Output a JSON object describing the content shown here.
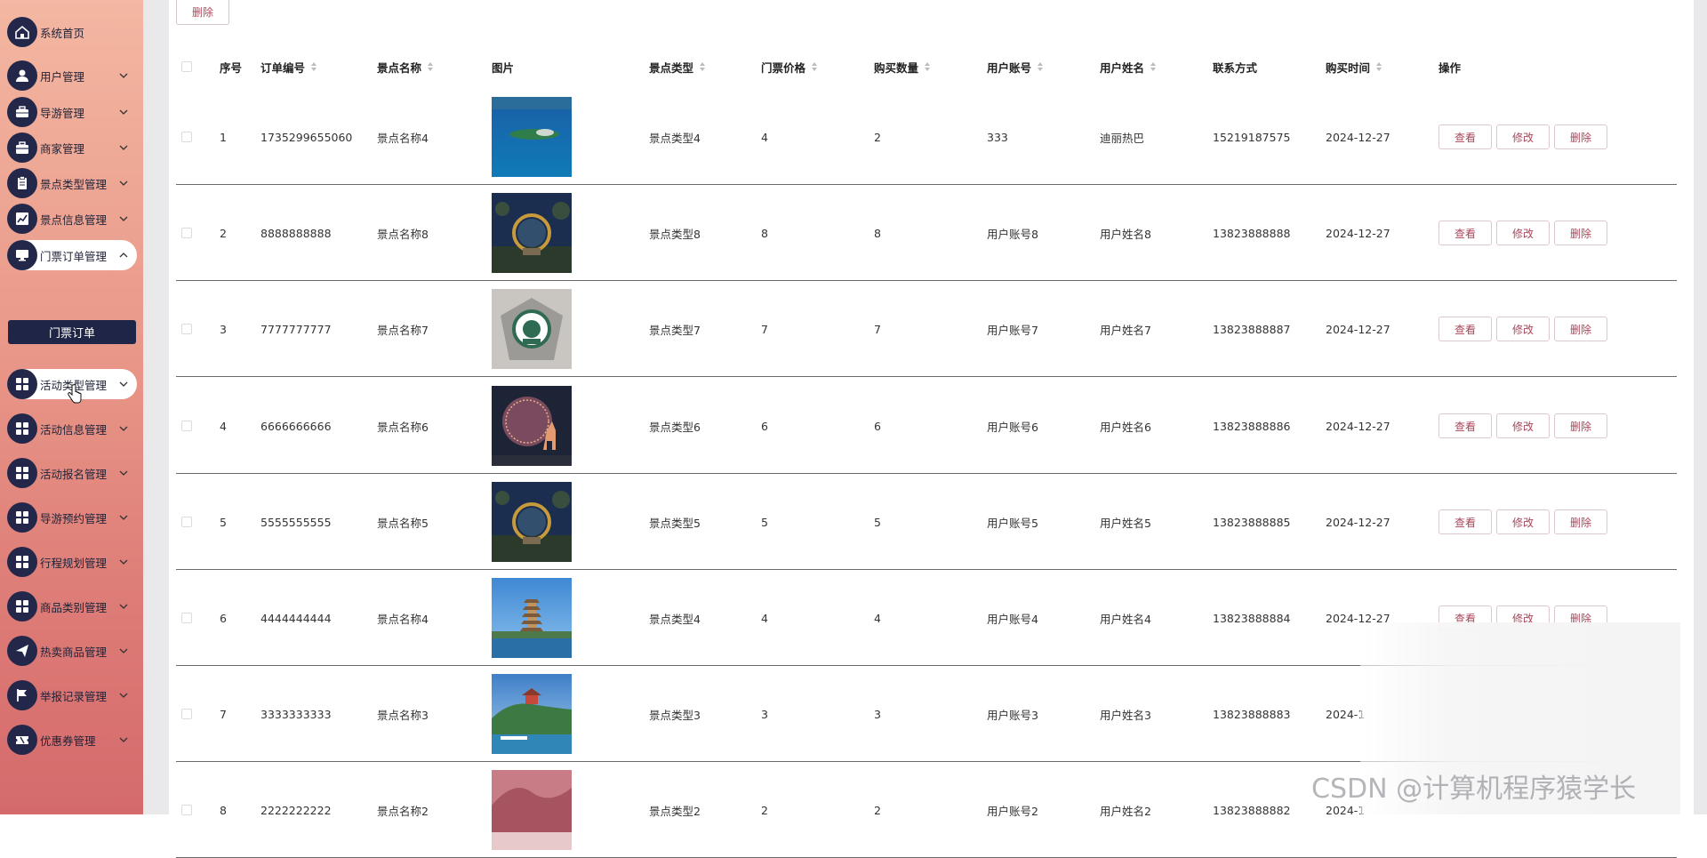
{
  "sidebar": {
    "items": [
      {
        "label": "系统首页",
        "icon": "home-icon",
        "caret": ""
      },
      {
        "label": "用户管理",
        "icon": "user-icon",
        "caret": "down"
      },
      {
        "label": "导游管理",
        "icon": "guide-icon",
        "caret": "down"
      },
      {
        "label": "商家管理",
        "icon": "briefcase-icon",
        "caret": "down"
      },
      {
        "label": "景点类型管理",
        "icon": "clipboard-icon",
        "caret": "down"
      },
      {
        "label": "景点信息管理",
        "icon": "chart-icon",
        "caret": "down"
      },
      {
        "label": "门票订单管理",
        "icon": "monitor-icon",
        "caret": "up"
      },
      {
        "label": "活动类型管理",
        "icon": "grid-icon",
        "caret": "down"
      },
      {
        "label": "活动信息管理",
        "icon": "grid-icon",
        "caret": "down"
      },
      {
        "label": "活动报名管理",
        "icon": "grid-icon",
        "caret": "down"
      },
      {
        "label": "导游预约管理",
        "icon": "grid-icon",
        "caret": "down"
      },
      {
        "label": "行程规划管理",
        "icon": "grid-icon",
        "caret": "down"
      },
      {
        "label": "商品类别管理",
        "icon": "grid-icon",
        "caret": "down"
      },
      {
        "label": "热卖商品管理",
        "icon": "send-icon",
        "caret": "down"
      },
      {
        "label": "举报记录管理",
        "icon": "flag-icon",
        "caret": "down"
      },
      {
        "label": "优惠券管理",
        "icon": "ticket-icon",
        "caret": "down"
      }
    ],
    "submenu": {
      "label": "门票订单"
    }
  },
  "toolbar": {
    "delete_label": "删除"
  },
  "table": {
    "columns": [
      "序号",
      "订单编号",
      "景点名称",
      "图片",
      "景点类型",
      "门票价格",
      "购买数量",
      "用户账号",
      "用户姓名",
      "联系方式",
      "购买时间",
      "操作"
    ],
    "actions": {
      "view": "查看",
      "edit": "修改",
      "delete": "删除"
    },
    "rows": [
      {
        "index": "1",
        "order_no": "1735299655060",
        "name": "景点名称4",
        "type": "景点类型4",
        "price": "4",
        "qty": "2",
        "account": "333",
        "user_name": "迪丽热巴",
        "phone": "15219187575",
        "time": "2024-12-27",
        "img": "lake-island"
      },
      {
        "index": "2",
        "order_no": "8888888888",
        "name": "景点名称8",
        "type": "景点类型8",
        "price": "8",
        "qty": "8",
        "account": "用户账号8",
        "user_name": "用户姓名8",
        "phone": "13823888888",
        "time": "2024-12-27",
        "img": "ring-night"
      },
      {
        "index": "3",
        "order_no": "7777777777",
        "name": "景点名称7",
        "type": "景点类型7",
        "price": "7",
        "qty": "7",
        "account": "用户账号7",
        "user_name": "用户姓名7",
        "phone": "13823888887",
        "time": "2024-12-27",
        "img": "badge"
      },
      {
        "index": "4",
        "order_no": "6666666666",
        "name": "景点名称6",
        "type": "景点类型6",
        "price": "6",
        "qty": "6",
        "account": "用户账号6",
        "user_name": "用户姓名6",
        "phone": "13823888886",
        "time": "2024-12-27",
        "img": "lantern-deer"
      },
      {
        "index": "5",
        "order_no": "5555555555",
        "name": "景点名称5",
        "type": "景点类型5",
        "price": "5",
        "qty": "5",
        "account": "用户账号5",
        "user_name": "用户姓名5",
        "phone": "13823888885",
        "time": "2024-12-27",
        "img": "ring-night"
      },
      {
        "index": "6",
        "order_no": "4444444444",
        "name": "景点名称4",
        "type": "景点类型4",
        "price": "4",
        "qty": "4",
        "account": "用户账号4",
        "user_name": "用户姓名4",
        "phone": "13823888884",
        "time": "2024-12-27",
        "img": "pagoda"
      },
      {
        "index": "7",
        "order_no": "3333333333",
        "name": "景点名称3",
        "type": "景点类型3",
        "price": "3",
        "qty": "3",
        "account": "用户账号3",
        "user_name": "用户姓名3",
        "phone": "13823888883",
        "time": "2024-1",
        "img": "coast-temple"
      },
      {
        "index": "8",
        "order_no": "2222222222",
        "name": "景点名称2",
        "type": "景点类型2",
        "price": "2",
        "qty": "2",
        "account": "用户账号2",
        "user_name": "用户姓名2",
        "phone": "13823888882",
        "time": "2024-1",
        "img": "red-mountain"
      }
    ]
  },
  "watermark": "CSDN @计算机程序猿学长",
  "colors": {
    "sidebar_icon_bg": "#23284a",
    "accent": "#a9465a",
    "submenu_bg": "#1f2547"
  }
}
